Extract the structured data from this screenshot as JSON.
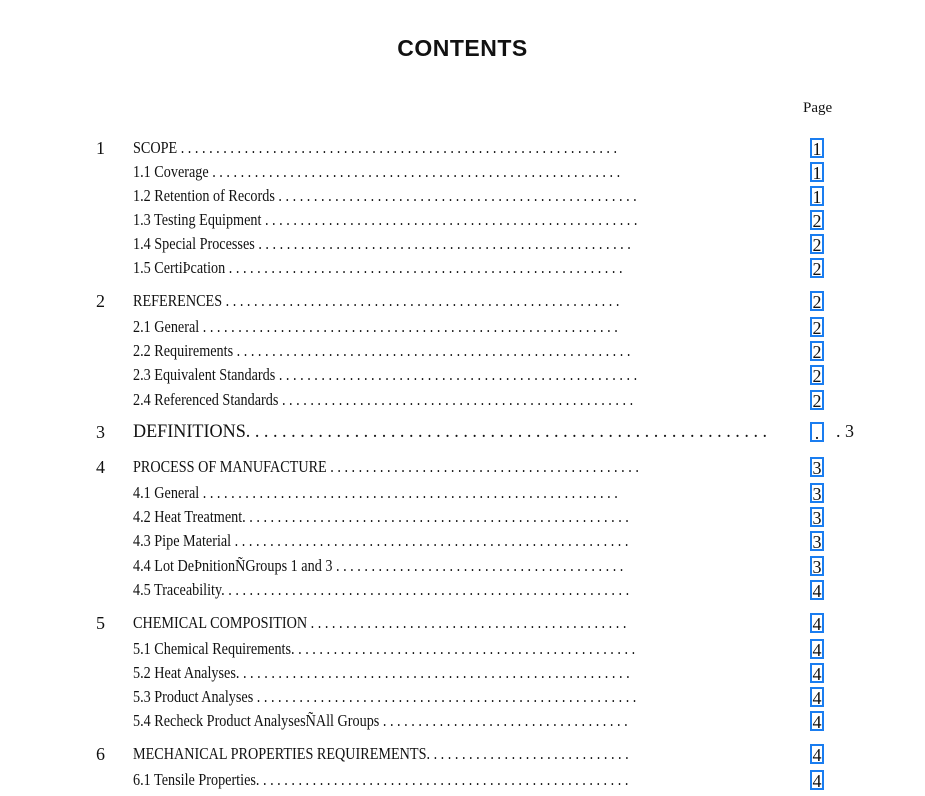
{
  "document": {
    "title": "CONTENTS",
    "page_column_header": "Page",
    "link_border_color": "#1a7df0",
    "entries": [
      {
        "num": "1",
        "label": "SCOPE . . . . . . . . . . . . . . . . . . . . . . . . . . . . . . . . . . . . . . . . . . . . . . . . . . . . . . . . . . . . . .",
        "page": "1"
      },
      {
        "num": "",
        "label": "1.1 Coverage . . . . . . . . . . . . . . . . . . . . . . . . . . . . . . . . . . . . . . . . . . . . . . . . . . . . . . . . . .",
        "page": "1"
      },
      {
        "num": "",
        "label": "1.2 Retention of Records . . . . . . . . . . . . . . . . . . . . . . . . . . . . . . . . . . . . . . . . . . . . . . . . . . .",
        "page": "1"
      },
      {
        "num": "",
        "label": "1.3 Testing Equipment . . . . . . . . . . . . . . . . . . . . . . . . . . . . . . . . . . . . . . . . . . . . . . . . . . . . .",
        "page": "2"
      },
      {
        "num": "",
        "label": "1.4 Special Processes . . . . . . . . . . . . . . . . . . . . . . . . . . . . . . . . . . . . . . . . . . . . . . . . . . . . .",
        "page": "2"
      },
      {
        "num": "",
        "label": "1.5 CertiÞcation . . . . . . . . . . . . . . . . . . . . . . . . . . . . . . . . . . . . . . . . . . . . . . . . . . . . . . . .",
        "page": "2"
      },
      {
        "num": "2",
        "label": "REFERENCES . . . . . . . . . . . . . . . . . . . . . . . . . . . . . . . . . . . . . . . . . . . . . . . . . . . . . . . .",
        "page": "2"
      },
      {
        "num": "",
        "label": "2.1 General . . . . . . . . . . . . . . . . . . . . . . . . . . . . . . . . . . . . . . . . . . . . . . . . . . . . . . . . . . .",
        "page": "2"
      },
      {
        "num": "",
        "label": "2.2 Requirements . . . . . . . . . . . . . . . . . . . . . . . . . . . . . . . . . . . . . . . . . . . . . . . . . . . . . . . .",
        "page": "2"
      },
      {
        "num": "",
        "label": "2.3 Equivalent Standards . . . . . . . . . . . . . . . . . . . . . . . . . . . . . . . . . . . . . . . . . . . . . . . . . . .",
        "page": "2"
      },
      {
        "num": "",
        "label": "2.4 Referenced Standards . . . . . . . . . . . . . . . . . . . . . . . . . . . . . . . . . . . . . . . . . . . . . . . . . .",
        "page": "2"
      },
      {
        "num": "3",
        "label": "DEFINITIONS. . . . . . . . . . . . . . . . . . . . . . . . . . . . . . . . . . . . . . . . . . . . . . . . . . . . . . . . . .",
        "page": ".",
        "extra": ". 3",
        "big": true
      },
      {
        "num": "4",
        "label": "PROCESS OF MANUFACTURE . . . . . . . . . . . . . . . . . . . . . . . . . . . . . . . . . . . . . . . . . . . .",
        "page": "3"
      },
      {
        "num": "",
        "label": "4.1 General . . . . . . . . . . . . . . . . . . . . . . . . . . . . . . . . . . . . . . . . . . . . . . . . . . . . . . . . . . .",
        "page": "3"
      },
      {
        "num": "",
        "label": "4.2 Heat Treatment. . . . . . . . . . . . . . . . . . . . . . . . . . . . . . . . . . . . . . . . . . . . . . . . . . . . . . .",
        "page": "3"
      },
      {
        "num": "",
        "label": "4.3 Pipe Material . . . . . . . . . . . . . . . . . . . . . . . . . . . . . . . . . . . . . . . . . . . . . . . . . . . . . . . .",
        "page": "3"
      },
      {
        "num": "",
        "label": "4.4 Lot DeÞnitionÑGroups 1 and 3 . . . . . . . . . . . . . . . . . . . . . . . . . . . . . . . . . . . . . . . . .",
        "page": "3"
      },
      {
        "num": "",
        "label": "4.5 Traceability. . . . . . . . . . . . . . . . . . . . . . . . . . . . . . . . . . . . . . . . . . . . . . . . . . . . . . . . . .",
        "page": "4"
      },
      {
        "num": "5",
        "label": "CHEMICAL COMPOSITION . . . . . . . . . . . . . . . . . . . . . . . . . . . . . . . . . . . . . . . . . . . . .",
        "page": "4"
      },
      {
        "num": "",
        "label": "5.1 Chemical Requirements. . . . . . . . . . . . . . . . . . . . . . . . . . . . . . . . . . . . . . . . . . . . . . . . .",
        "page": "4"
      },
      {
        "num": "",
        "label": "5.2 Heat Analyses. . . . . . . . . . . . . . . . . . . . . . . . . . . . . . . . . . . . . . . . . . . . . . . . . . . . . . . .",
        "page": "4"
      },
      {
        "num": "",
        "label": "5.3 Product Analyses . . . . . . . . . . . . . . . . . . . . . . . . . . . . . . . . . . . . . . . . . . . . . . . . . . . . . .",
        "page": "4"
      },
      {
        "num": "",
        "label": "5.4 Recheck Product AnalysesÑAll Groups . . . . . . . . . . . . . . . . . . . . . . . . . . . . . . . . . . .",
        "page": "4"
      },
      {
        "num": "6",
        "label": "MECHANICAL PROPERTIES REQUIREMENTS. . . . . . . . . . . . . . . . . . . . . . . . . . . . .",
        "page": "4"
      },
      {
        "num": "",
        "label": "6.1 Tensile Properties. . . . . . . . . . . . . . . . . . . . . . . . . . . . . . . . . . . . . . . . . . . . . . . . . . . . .",
        "page": "4"
      }
    ]
  }
}
